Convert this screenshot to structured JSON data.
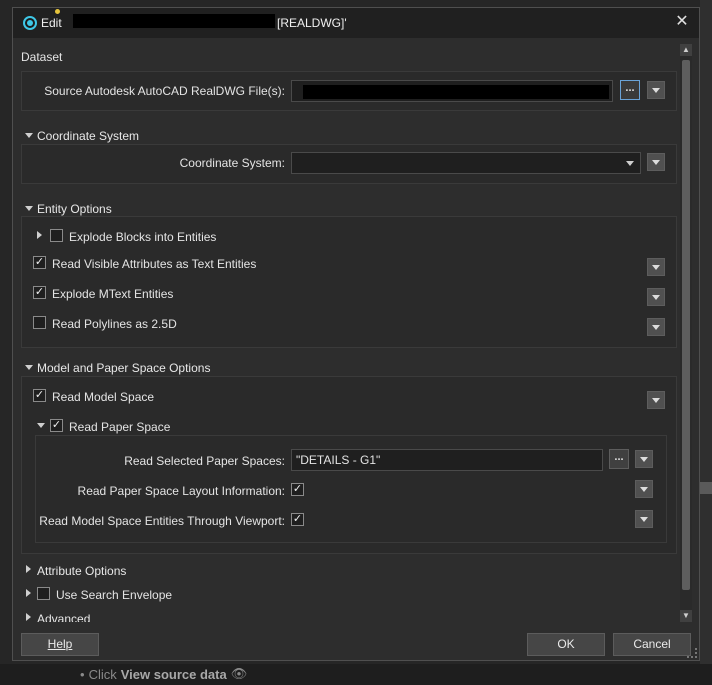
{
  "window": {
    "title_prefix": "Edit",
    "title_suffix": "[REALDWG]'",
    "close_glyph": "✕"
  },
  "background": {
    "click": "Click",
    "view_source": "View source data"
  },
  "dataset": {
    "header": "Dataset",
    "source_label": "Source Autodesk AutoCAD RealDWG File(s):",
    "browse_label": "..."
  },
  "coordinate_system": {
    "header": "Coordinate System",
    "label": "Coordinate System:",
    "value": ""
  },
  "entity_options": {
    "header": "Entity Options",
    "explode_blocks": {
      "label": "Explode Blocks into Entities",
      "checked": false
    },
    "read_visible_attributes": {
      "label": "Read Visible Attributes as Text Entities",
      "checked": true
    },
    "explode_mtext": {
      "label": "Explode MText Entities",
      "checked": true
    },
    "read_polylines": {
      "label": "Read Polylines as 2.5D",
      "checked": false
    }
  },
  "model_paper": {
    "header": "Model and Paper Space Options",
    "read_model_space": {
      "label": "Read Model Space",
      "checked": true
    },
    "read_paper_space": {
      "label": "Read Paper Space",
      "checked": true
    },
    "selected_paper_spaces": {
      "label": "Read Selected Paper Spaces:",
      "value": "\"DETAILS - G1\"",
      "browse": "..."
    },
    "layout_info": {
      "label": "Read Paper Space Layout Information:",
      "checked": true
    },
    "through_viewport": {
      "label": "Read Model Space Entities Through Viewport:",
      "checked": true
    }
  },
  "collapsed_sections": {
    "attribute_options": "Attribute Options",
    "use_search_envelope": "Use Search Envelope",
    "advanced": "Advanced"
  },
  "buttons": {
    "help": "Help",
    "ok": "OK",
    "cancel": "Cancel"
  },
  "colors": {
    "accent": "#3ec7e6",
    "title_dot": "#e6c43c",
    "browse_border": "#6aa3d8"
  }
}
